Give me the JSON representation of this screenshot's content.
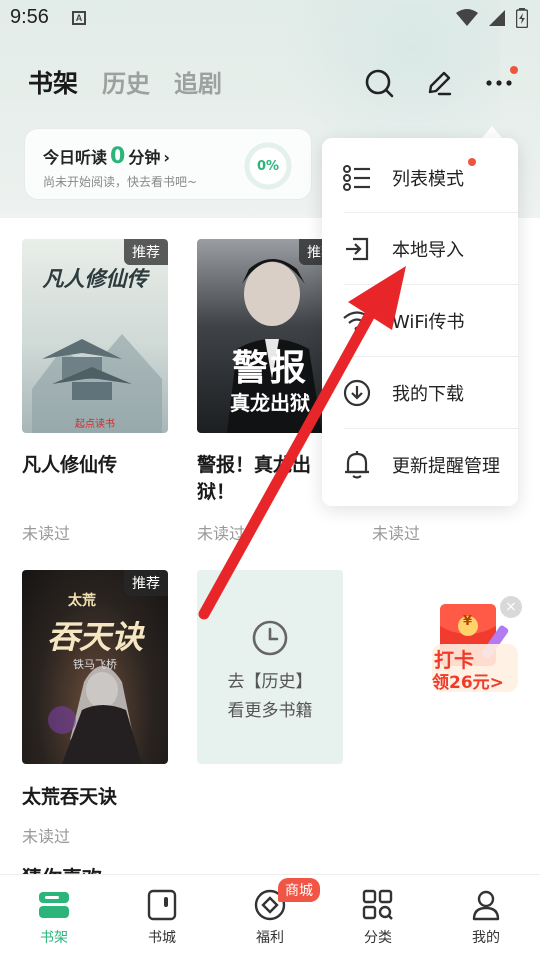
{
  "status_bar": {
    "time": "9:56",
    "a_icon": "A"
  },
  "tabs": [
    {
      "label": "书架",
      "active": true
    },
    {
      "label": "历史",
      "active": false
    },
    {
      "label": "追剧",
      "active": false
    }
  ],
  "reading": {
    "prefix": "今日听读",
    "minutes": "0",
    "suffix": "分钟",
    "chevron": "›",
    "subtitle": "尚未开始阅读，快去看书吧~",
    "progress": "0%"
  },
  "books": [
    {
      "title": "凡人修仙传",
      "status": "未读过",
      "tag": "推荐",
      "cover_title": "凡人修仙传",
      "cover_publisher": "起点读书"
    },
    {
      "title": "警报！真龙出狱！",
      "title_line1": "警报！真龙出",
      "title_line2": "狱！",
      "status": "未读过",
      "tag": "推荐",
      "cover_title1": "警报",
      "cover_title2": "真龙出狱"
    },
    {
      "title": "",
      "status": "未读过"
    },
    {
      "title": "太荒吞天诀",
      "status": "未读过",
      "tag": "推荐",
      "cover_title_top": "太荒",
      "cover_title": "吞天诀",
      "cover_author": "铁马飞桥"
    }
  ],
  "history_card": {
    "line1": "去【历史】",
    "line2": "看更多书籍"
  },
  "promo": {
    "line1": "打卡",
    "line2": "领26元>",
    "close": "×",
    "yen": "¥"
  },
  "partial_title": "猜你喜欢",
  "menu": {
    "items": [
      {
        "label": "列表模式",
        "icon": "list-icon",
        "has_dot": true
      },
      {
        "label": "本地导入",
        "icon": "import-icon"
      },
      {
        "label": "WiFi传书",
        "icon": "wifi-icon"
      },
      {
        "label": "我的下载",
        "icon": "download-icon"
      },
      {
        "label": "更新提醒管理",
        "icon": "bell-icon"
      }
    ]
  },
  "bottom_nav": {
    "items": [
      {
        "label": "书架",
        "icon": "bookshelf-icon",
        "active": true
      },
      {
        "label": "书城",
        "icon": "bookstore-icon"
      },
      {
        "label": "福利",
        "icon": "welfare-icon"
      },
      {
        "label": "分类",
        "icon": "category-icon"
      },
      {
        "label": "我的",
        "icon": "profile-icon"
      }
    ],
    "badge": "商城"
  },
  "colors": {
    "accent": "#2bb57a",
    "badge_red": "#f05545",
    "arrow_red": "#e8262a"
  }
}
